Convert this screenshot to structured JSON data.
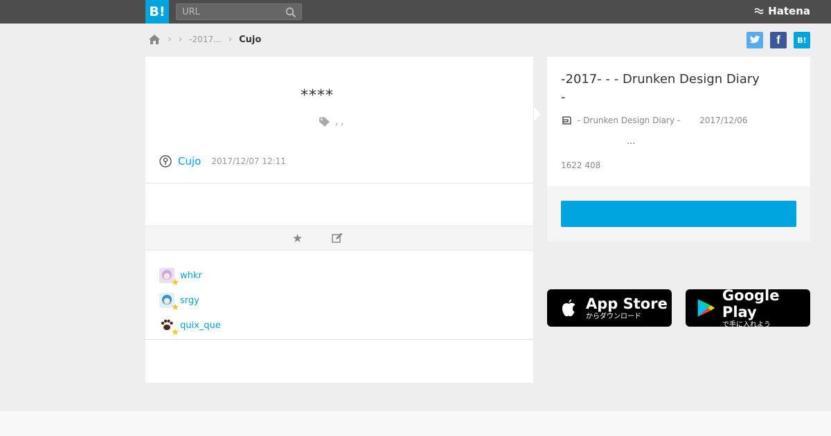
{
  "header": {
    "logo_text": "B!",
    "search_placeholder": "URL",
    "brand": "Hatena"
  },
  "breadcrumb": {
    "items": [
      "-2017..."
    ],
    "current": "Cujo"
  },
  "share": {
    "twitter": "t",
    "facebook": "f",
    "hatena": "B!"
  },
  "comment": {
    "text": "****",
    "tags": ",  ,",
    "user": "Cujo",
    "timestamp": "2017/12/07 12:11"
  },
  "stars": [
    {
      "name": "whkr"
    },
    {
      "name": "srgy"
    },
    {
      "name": "quix_que"
    }
  ],
  "entry": {
    "title_line1": "-2017- -  - Drunken Design Diary",
    "title_line2": "-",
    "site": "- Drunken Design Diary -",
    "date": "2017/12/06",
    "excerpt": "...",
    "count": "1622 408"
  },
  "apps": {
    "appstore_title": "App Store",
    "appstore_sub": "からダウンロード",
    "googleplay_title": "Google Play",
    "googleplay_sub": "で手に入れよう"
  },
  "colors": {
    "accent": "#00a4de",
    "topbar": "#4d4d4d",
    "twitter": "#55acee",
    "facebook": "#3b5998"
  }
}
